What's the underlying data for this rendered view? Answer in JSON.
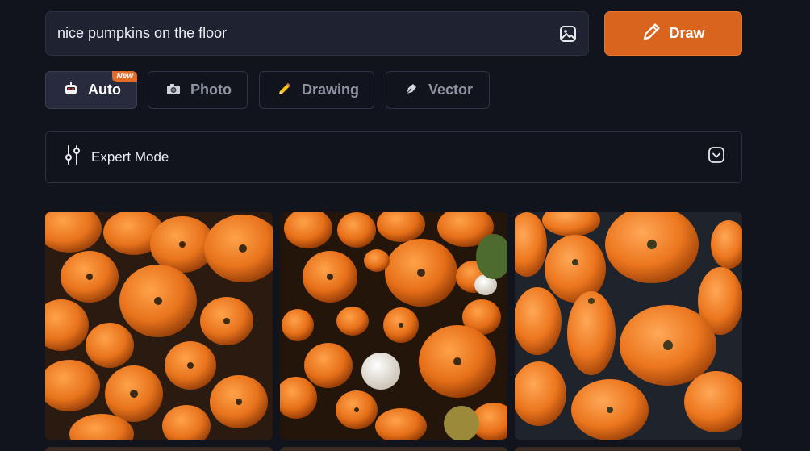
{
  "prompt": {
    "value": "nice pumpkins on the floor",
    "upload_icon": "image-icon"
  },
  "draw_button": {
    "label": "Draw",
    "icon": "pencil-icon"
  },
  "styles": [
    {
      "label": "Auto",
      "icon": "robot-icon",
      "badge": "New",
      "active": true
    },
    {
      "label": "Photo",
      "icon": "camera-icon",
      "active": false
    },
    {
      "label": "Drawing",
      "icon": "pencil-icon",
      "active": false
    },
    {
      "label": "Vector",
      "icon": "pen-nib-icon",
      "active": false
    }
  ],
  "expert_mode": {
    "label": "Expert Mode",
    "icon": "sliders-icon",
    "toggle_icon": "chevron-down-icon"
  },
  "gallery": {
    "images": [
      {
        "subject": "pumpkins"
      },
      {
        "subject": "pumpkins"
      },
      {
        "subject": "pumpkins"
      }
    ]
  },
  "colors": {
    "accent": "#d8641e",
    "background": "#12141d",
    "panel": "#1f2231",
    "pumpkin": "#e8731c"
  }
}
